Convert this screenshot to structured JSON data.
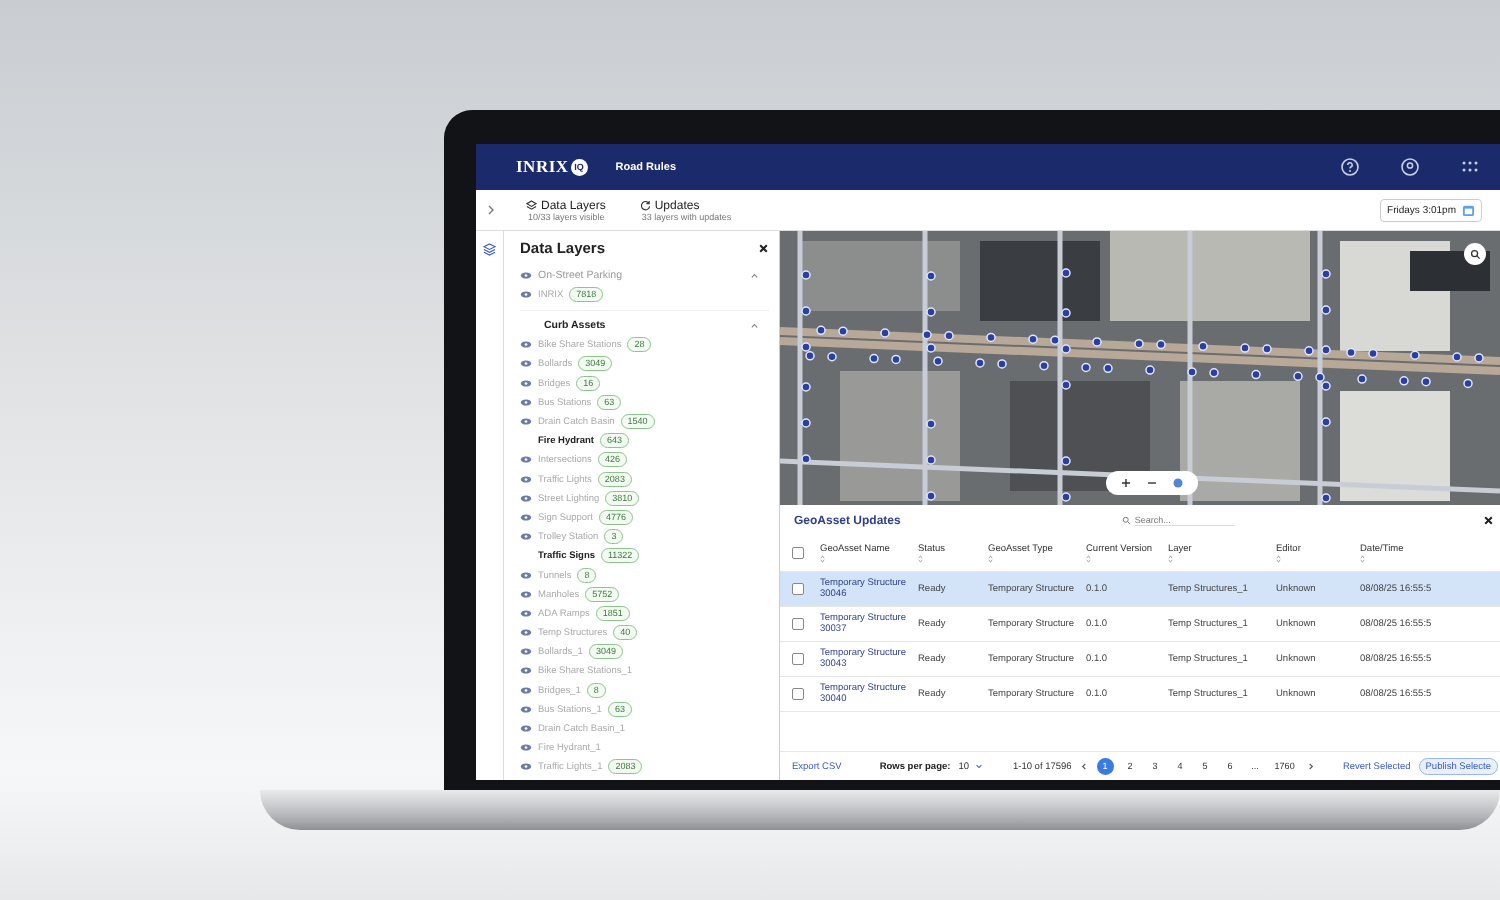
{
  "app": {
    "logo_text": "INRIX",
    "logo_badge": "IQ",
    "title": "Road Rules"
  },
  "tabs": [
    {
      "label": "Data Layers",
      "sublabel": "10/33 layers visible",
      "kind": "layers"
    },
    {
      "label": "Updates",
      "sublabel": "33 layers with updates",
      "kind": "updates"
    }
  ],
  "time_button": "Fridays 3:01pm",
  "layers_panel": {
    "title": "Data Layers",
    "groups": [
      {
        "name": "On-Street Parking",
        "visible": false,
        "expanded": true,
        "items": [
          {
            "name": "INRIX",
            "count": "7818",
            "visible": false
          }
        ]
      },
      {
        "name": "Curb Assets",
        "visible": true,
        "expanded": true,
        "items": [
          {
            "name": "Bike Share Stations",
            "count": "28",
            "visible": false
          },
          {
            "name": "Bollards",
            "count": "3049",
            "visible": false
          },
          {
            "name": "Bridges",
            "count": "16",
            "visible": false
          },
          {
            "name": "Bus Stations",
            "count": "63",
            "visible": false
          },
          {
            "name": "Drain Catch Basin",
            "count": "1540",
            "visible": false
          },
          {
            "name": "Fire Hydrant",
            "count": "643",
            "visible": true
          },
          {
            "name": "Intersections",
            "count": "426",
            "visible": false
          },
          {
            "name": "Traffic Lights",
            "count": "2083",
            "visible": false
          },
          {
            "name": "Street Lighting",
            "count": "3810",
            "visible": false
          },
          {
            "name": "Sign Support",
            "count": "4776",
            "visible": false
          },
          {
            "name": "Trolley Station",
            "count": "3",
            "visible": false
          },
          {
            "name": "Traffic Signs",
            "count": "11322",
            "visible": true
          },
          {
            "name": "Tunnels",
            "count": "8",
            "visible": false
          },
          {
            "name": "Manholes",
            "count": "5752",
            "visible": false
          },
          {
            "name": "ADA Ramps",
            "count": "1851",
            "visible": false
          },
          {
            "name": "Temp Structures",
            "count": "40",
            "visible": false
          },
          {
            "name": "Bollards_1",
            "count": "3049",
            "visible": false
          },
          {
            "name": "Bike Share Stations_1",
            "visible": false
          },
          {
            "name": "Bridges_1",
            "count": "8",
            "visible": false
          },
          {
            "name": "Bus Stations_1",
            "count": "63",
            "visible": false
          },
          {
            "name": "Drain Catch Basin_1",
            "visible": false
          },
          {
            "name": "Fire Hydrant_1",
            "visible": false
          },
          {
            "name": "Traffic Lights_1",
            "count": "2083",
            "visible": false
          }
        ]
      }
    ]
  },
  "table": {
    "title": "GeoAsset Updates",
    "search": {
      "placeholder": "Search..."
    },
    "select_all": {
      "checked": false
    },
    "columns": [
      "GeoAsset Name",
      "Status",
      "GeoAsset Type",
      "Current Version",
      "Layer",
      "Editor",
      "Date/Time"
    ],
    "rows": [
      {
        "selected": true,
        "checked": false,
        "cells": [
          "Temporary Structure 30046",
          "Ready",
          "Temporary Structure",
          "0.1.0",
          "Temp Structures_1",
          "Unknown",
          "08/08/25 16:55:5"
        ]
      },
      {
        "selected": false,
        "checked": false,
        "cells": [
          "Temporary Structure 30037",
          "Ready",
          "Temporary Structure",
          "0.1.0",
          "Temp Structures_1",
          "Unknown",
          "08/08/25 16:55:5"
        ]
      },
      {
        "selected": false,
        "checked": false,
        "cells": [
          "Temporary Structure 30043",
          "Ready",
          "Temporary Structure",
          "0.1.0",
          "Temp Structures_1",
          "Unknown",
          "08/08/25 16:55:5"
        ]
      },
      {
        "selected": false,
        "checked": false,
        "cells": [
          "Temporary Structure 30040",
          "Ready",
          "Temporary Structure",
          "0.1.0",
          "Temp Structures_1",
          "Unknown",
          "08/08/25 16:55:5"
        ]
      }
    ],
    "footer": {
      "export": "Export CSV",
      "rows_label": "Rows per page:",
      "rows_value": "10",
      "range": "1-10 of 17596",
      "pages": [
        {
          "label": "1",
          "selected": true
        },
        {
          "label": "2",
          "selected": false
        },
        {
          "label": "3",
          "selected": false
        },
        {
          "label": "4",
          "selected": false
        },
        {
          "label": "5",
          "selected": false
        },
        {
          "label": "6",
          "selected": false
        },
        {
          "label": "...",
          "selected": false
        },
        {
          "label": "1760",
          "selected": false
        }
      ],
      "revert": "Revert Selected",
      "publish": "Publish Selecte"
    }
  }
}
